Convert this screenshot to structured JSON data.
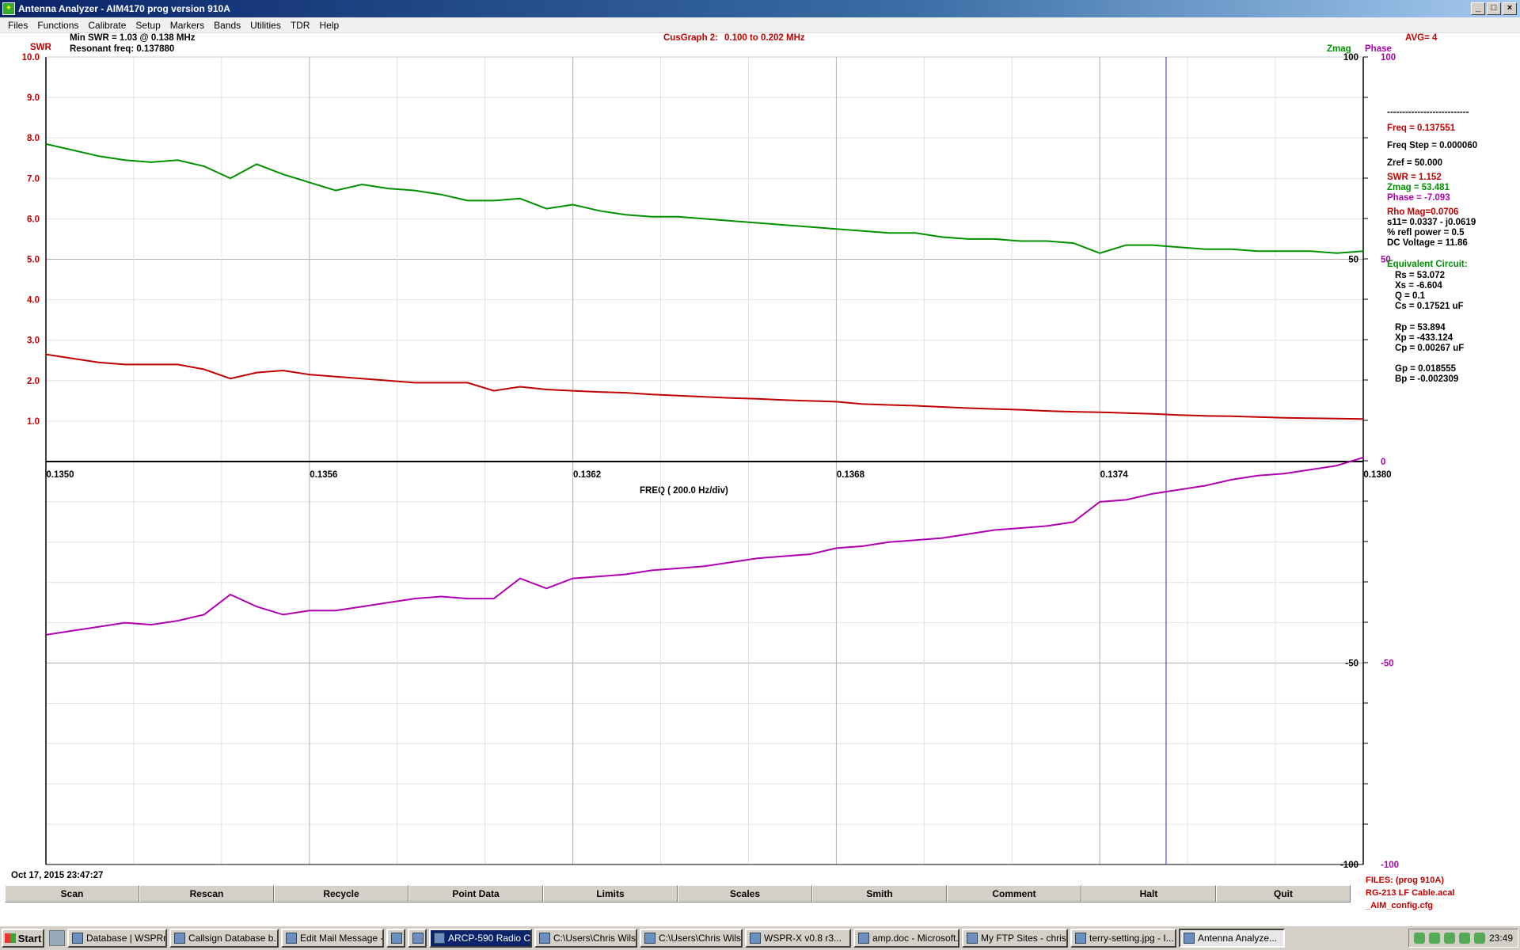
{
  "window": {
    "title": "Antenna Analyzer - AIM4170   prog version 910A"
  },
  "menu": [
    "Files",
    "Functions",
    "Calibrate",
    "Setup",
    "Markers",
    "Bands",
    "Utilities",
    "TDR",
    "Help"
  ],
  "header": {
    "min_swr": "Min SWR =   1.03 @  0.138 MHz",
    "resonant": "Resonant freq:  0.137880",
    "cus_graph": "CusGraph  2:",
    "range": "0.100 to 0.202 MHz",
    "avg": "AVG=  4",
    "swr_label": "SWR",
    "zmag_label": "Zmag",
    "phase_label": "Phase",
    "freq_axis": "FREQ ( 200.0 Hz/div)",
    "timestamp": "Oct 17, 2015  23:47:27"
  },
  "readout": {
    "dashes": "---------------------------",
    "freq": "Freq = 0.137551",
    "freq_step": "Freq Step = 0.000060",
    "zref": "Zref =   50.000",
    "swr": "SWR =    1.152",
    "zmag": "Zmag =   53.481",
    "phase": "Phase =   -7.093",
    "rho": "Rho Mag=0.0706",
    "s11": "s11= 0.0337 - j0.0619",
    "refl": "% refl power =  0.5",
    "dcv": "DC Voltage =  11.86",
    "eq_title": "Equivalent Circuit:",
    "rs": "Rs =   53.072",
    "xs": "Xs =   -6.604",
    "q": "Q =  0.1",
    "cs": "Cs =   0.17521  uF",
    "rp": "Rp =   53.894",
    "xp": "Xp = -433.124",
    "cp": "Cp =   0.00267  uF",
    "gp": "Gp =  0.018555",
    "bp": "Bp = -0.002309"
  },
  "buttons": [
    "Scan",
    "Rescan",
    "Recycle",
    "Point Data",
    "Limits",
    "Scales",
    "Smith",
    "Comment",
    "Halt",
    "Quit"
  ],
  "files": {
    "line1": "FILES:  (prog 910A)",
    "line2": "RG-213 LF Cable.acal",
    "line3": "_AIM_config.cfg"
  },
  "taskbar": {
    "start": "Start",
    "tasks": [
      "Database | WSPRn...",
      "Callsign Database b...",
      "Edit Mail Message -...",
      "",
      "ARCP-590 Radio Co...",
      "C:\\Users\\Chris Wils...",
      "C:\\Users\\Chris Wils...",
      "WSPR-X   v0.8  r3...",
      "amp.doc - Microsoft...",
      "My FTP Sites - chris...",
      "terry-setting.jpg - I...",
      "Antenna Analyze..."
    ],
    "clock": "23:49"
  },
  "colors": {
    "swr": "#c00000",
    "zmag": "#009000",
    "phase": "#b000b0",
    "cursor": "#3030a0"
  },
  "chart_data": {
    "type": "line",
    "x_range": [
      0.135,
      0.138
    ],
    "x_ticks": [
      "0.1350",
      "0.1356",
      "0.1362",
      "0.1368",
      "0.1374",
      "0.1380"
    ],
    "swr_axis": {
      "range": [
        0,
        10
      ],
      "ticks": [
        "10.0",
        "9.0",
        "8.0",
        "7.0",
        "6.0",
        "5.0",
        "4.0",
        "3.0",
        "2.0",
        "1.0"
      ]
    },
    "zmag_axis": {
      "range": [
        -100,
        100
      ],
      "ticks": [
        "100",
        "50",
        "-50",
        "-100"
      ]
    },
    "phase_axis": {
      "range": [
        -100,
        100
      ],
      "ticks": [
        "100",
        "50",
        "0",
        "-50",
        "-100"
      ]
    },
    "cursor_x": 0.137551,
    "x": [
      0.135,
      0.13506,
      0.13512,
      0.13518,
      0.13524,
      0.1353,
      0.13536,
      0.13542,
      0.13548,
      0.13554,
      0.1356,
      0.13566,
      0.13572,
      0.13578,
      0.13584,
      0.1359,
      0.13596,
      0.13602,
      0.13608,
      0.13614,
      0.1362,
      0.13626,
      0.13632,
      0.13638,
      0.13644,
      0.1365,
      0.13656,
      0.13662,
      0.13668,
      0.13674,
      0.1368,
      0.13686,
      0.13692,
      0.13698,
      0.13704,
      0.1371,
      0.13716,
      0.13722,
      0.13728,
      0.13734,
      0.1374,
      0.13746,
      0.13752,
      0.13758,
      0.13764,
      0.1377,
      0.13776,
      0.13782,
      0.13788,
      0.13794,
      0.138
    ],
    "series": [
      {
        "name": "SWR",
        "values": [
          2.65,
          2.55,
          2.45,
          2.4,
          2.4,
          2.4,
          2.28,
          2.05,
          2.2,
          2.25,
          2.15,
          2.1,
          2.05,
          2.0,
          1.95,
          1.95,
          1.95,
          1.75,
          1.85,
          1.78,
          1.75,
          1.72,
          1.7,
          1.66,
          1.63,
          1.6,
          1.57,
          1.55,
          1.52,
          1.5,
          1.48,
          1.42,
          1.4,
          1.38,
          1.35,
          1.32,
          1.3,
          1.28,
          1.25,
          1.23,
          1.22,
          1.2,
          1.18,
          1.15,
          1.13,
          1.12,
          1.1,
          1.08,
          1.07,
          1.06,
          1.05
        ]
      },
      {
        "name": "Zmag",
        "values": [
          78.5,
          77,
          75.5,
          74.5,
          74,
          74.5,
          73,
          70,
          73.5,
          71,
          69,
          67,
          68.5,
          67.5,
          67,
          66,
          64.5,
          64.5,
          65,
          62.5,
          63.5,
          62,
          61,
          60.5,
          60.5,
          60,
          59.5,
          59,
          58.5,
          58,
          57.5,
          57,
          56.5,
          56.5,
          55.5,
          55,
          55,
          54.5,
          54.5,
          54,
          51.5,
          53.5,
          53.5,
          53,
          52.5,
          52.5,
          52,
          52,
          52,
          51.5,
          52
        ]
      },
      {
        "name": "Phase",
        "values": [
          -43,
          -42,
          -41,
          -40,
          -40.5,
          -39.5,
          -38,
          -33,
          -36,
          -38,
          -37,
          -37,
          -36,
          -35,
          -34,
          -33.5,
          -34,
          -34,
          -29,
          -31.5,
          -29,
          -28.5,
          -28,
          -27,
          -26.5,
          -26,
          -25,
          -24,
          -23.5,
          -23,
          -21.5,
          -21,
          -20,
          -19.5,
          -19,
          -18,
          -17,
          -16.5,
          -16,
          -15,
          -10,
          -9.5,
          -8,
          -7,
          -6,
          -4.5,
          -3.5,
          -3,
          -2,
          -1,
          1
        ]
      }
    ]
  }
}
